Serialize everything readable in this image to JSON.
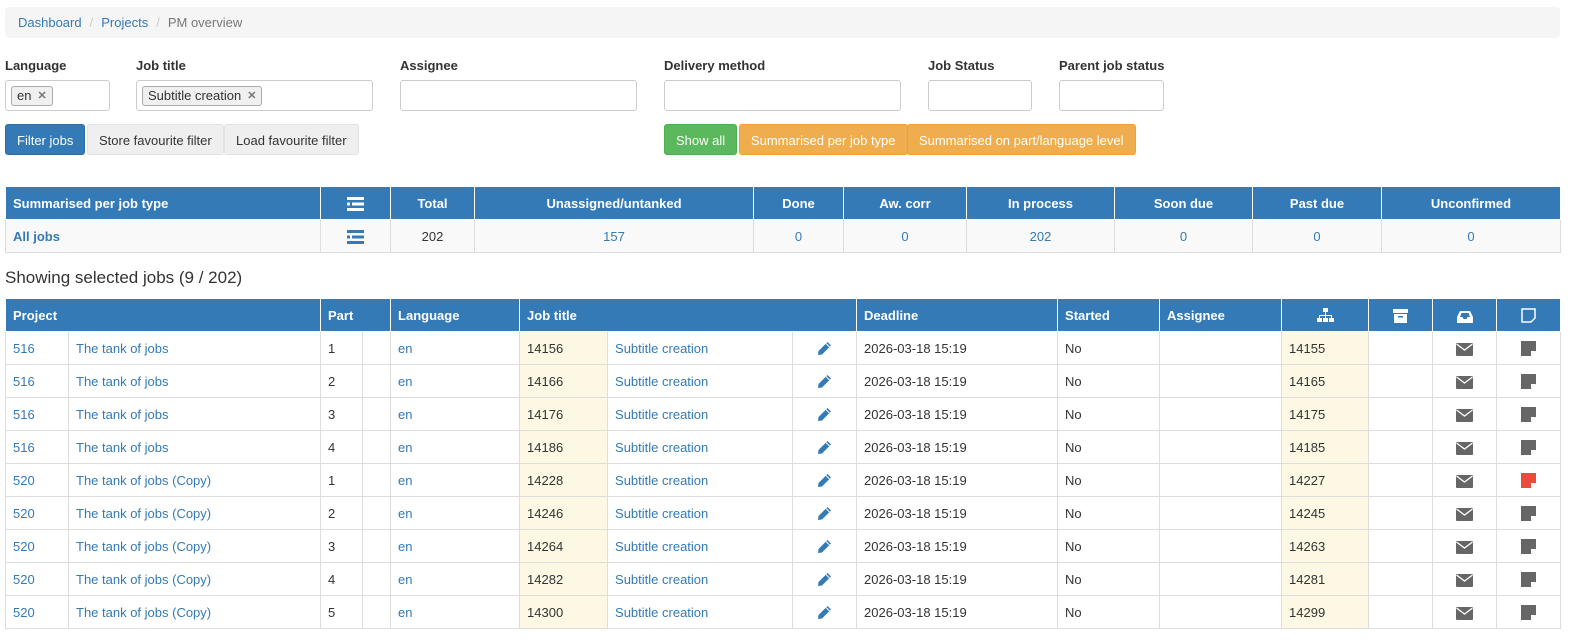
{
  "breadcrumb": [
    {
      "label": "Dashboard"
    },
    {
      "label": "Projects"
    },
    {
      "label": "PM overview"
    }
  ],
  "filters": {
    "language": {
      "label": "Language",
      "chips": [
        "en"
      ]
    },
    "job_title": {
      "label": "Job title",
      "chips": [
        "Subtitle creation"
      ]
    },
    "assignee": {
      "label": "Assignee"
    },
    "delivery_method": {
      "label": "Delivery method"
    },
    "job_status": {
      "label": "Job Status"
    },
    "parent_job_status": {
      "label": "Parent job status"
    }
  },
  "buttons": {
    "filter_jobs": "Filter jobs",
    "store_favourite": "Store favourite filter",
    "load_favourite": "Load favourite filter",
    "show_all": "Show all",
    "summarised_job_type": "Summarised per job type",
    "summarised_part_language": "Summarised on part/language level"
  },
  "summary": {
    "headers": [
      "Summarised per job type",
      "",
      "Total",
      "Unassigned/untanked",
      "Done",
      "Aw. corr",
      "In process",
      "Soon due",
      "Past due",
      "Unconfirmed"
    ],
    "row": {
      "label": "All jobs",
      "total": "202",
      "unassigned": "157",
      "done": "0",
      "aw_corr": "0",
      "in_process": "202",
      "soon_due": "0",
      "past_due": "0",
      "unconfirmed": "0"
    }
  },
  "selection_title": "Showing selected jobs (9 / 202)",
  "jobs": {
    "headers": {
      "project": "Project",
      "part": "Part",
      "language": "Language",
      "job_title": "Job title",
      "deadline": "Deadline",
      "started": "Started",
      "assignee": "Assignee"
    },
    "rows": [
      {
        "project_id": "516",
        "project_name": "The tank of jobs",
        "part": "1",
        "language": "en",
        "job_id": "14156",
        "job_title": "Subtitle creation",
        "deadline": "2026-03-18 15:19",
        "started": "No",
        "assignee": "",
        "parent_id": "14155",
        "note_flag": false
      },
      {
        "project_id": "516",
        "project_name": "The tank of jobs",
        "part": "2",
        "language": "en",
        "job_id": "14166",
        "job_title": "Subtitle creation",
        "deadline": "2026-03-18 15:19",
        "started": "No",
        "assignee": "",
        "parent_id": "14165",
        "note_flag": false
      },
      {
        "project_id": "516",
        "project_name": "The tank of jobs",
        "part": "3",
        "language": "en",
        "job_id": "14176",
        "job_title": "Subtitle creation",
        "deadline": "2026-03-18 15:19",
        "started": "No",
        "assignee": "",
        "parent_id": "14175",
        "note_flag": false
      },
      {
        "project_id": "516",
        "project_name": "The tank of jobs",
        "part": "4",
        "language": "en",
        "job_id": "14186",
        "job_title": "Subtitle creation",
        "deadline": "2026-03-18 15:19",
        "started": "No",
        "assignee": "",
        "parent_id": "14185",
        "note_flag": false
      },
      {
        "project_id": "520",
        "project_name": "The tank of jobs (Copy)",
        "part": "1",
        "language": "en",
        "job_id": "14228",
        "job_title": "Subtitle creation",
        "deadline": "2026-03-18 15:19",
        "started": "No",
        "assignee": "",
        "parent_id": "14227",
        "note_flag": true
      },
      {
        "project_id": "520",
        "project_name": "The tank of jobs (Copy)",
        "part": "2",
        "language": "en",
        "job_id": "14246",
        "job_title": "Subtitle creation",
        "deadline": "2026-03-18 15:19",
        "started": "No",
        "assignee": "",
        "parent_id": "14245",
        "note_flag": false
      },
      {
        "project_id": "520",
        "project_name": "The tank of jobs (Copy)",
        "part": "3",
        "language": "en",
        "job_id": "14264",
        "job_title": "Subtitle creation",
        "deadline": "2026-03-18 15:19",
        "started": "No",
        "assignee": "",
        "parent_id": "14263",
        "note_flag": false
      },
      {
        "project_id": "520",
        "project_name": "The tank of jobs (Copy)",
        "part": "4",
        "language": "en",
        "job_id": "14282",
        "job_title": "Subtitle creation",
        "deadline": "2026-03-18 15:19",
        "started": "No",
        "assignee": "",
        "parent_id": "14281",
        "note_flag": false
      },
      {
        "project_id": "520",
        "project_name": "The tank of jobs (Copy)",
        "part": "5",
        "language": "en",
        "job_id": "14300",
        "job_title": "Subtitle creation",
        "deadline": "2026-03-18 15:19",
        "started": "No",
        "assignee": "",
        "parent_id": "14299",
        "note_flag": false
      }
    ]
  },
  "colors": {
    "primary": "#337ab7",
    "success": "#5cb85c",
    "warning": "#f0ad4e",
    "highlight": "#fcf8e3",
    "note_red": "#e74c3c",
    "note_grey": "#666666"
  },
  "icons": {
    "summary_header": "list-icon",
    "summary_row": "list-icon",
    "edit": "pencil-icon",
    "parent": "sitemap-icon",
    "archive": "archive-icon",
    "inbox": "inbox-icon",
    "note": "note-icon",
    "mail": "envelope-icon"
  }
}
